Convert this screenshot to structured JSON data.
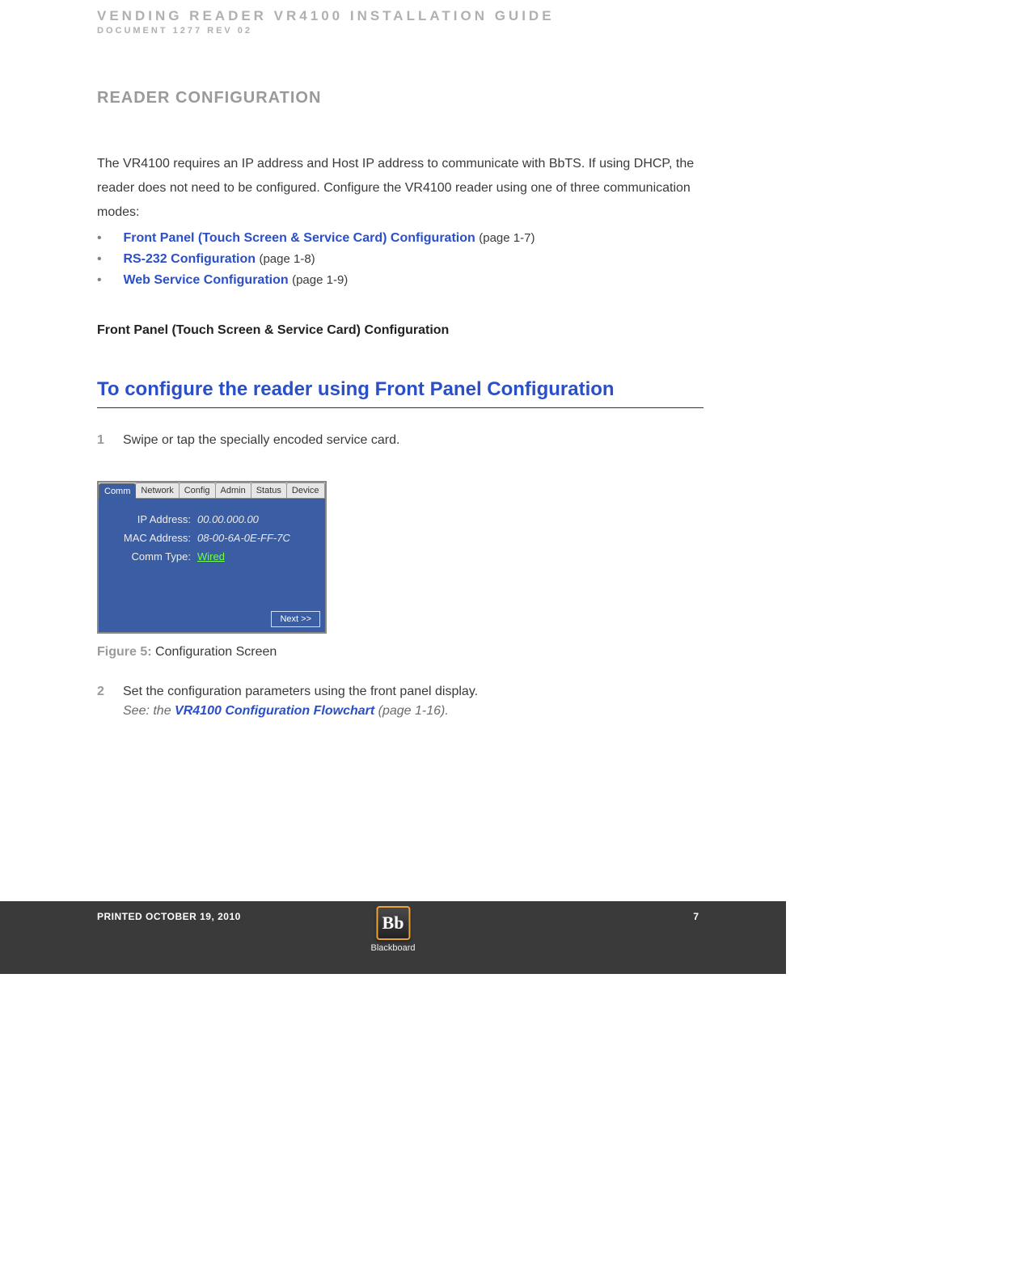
{
  "header": {
    "title": "VENDING READER VR4100 INSTALLATION GUIDE",
    "subtitle": "DOCUMENT 1277   REV 02"
  },
  "section_title": "READER CONFIGURATION",
  "intro": "The VR4100 requires an IP address and Host IP address to communicate with BbTS. If using DHCP, the reader does not need to be configured. Configure the VR4100 reader using one of three communication modes:",
  "links": [
    {
      "label": "Front Panel (Touch Screen & Service Card) Configuration",
      "page": "(page 1-7)"
    },
    {
      "label": "RS-232 Configuration",
      "page": "(page 1-8)"
    },
    {
      "label": "Web Service Configuration",
      "page": "(page 1-9)"
    }
  ],
  "subsection": "Front Panel (Touch Screen & Service Card) Configuration",
  "procedure_title": "To configure the reader using Front Panel Configuration",
  "steps": {
    "s1_num": "1",
    "s1_text": "Swipe or tap the specially encoded service card.",
    "s2_num": "2",
    "s2_text": "Set the configuration parameters using the front panel display.",
    "s2_see_prefix": "See: the ",
    "s2_see_link": "VR4100 Configuration Flowchart",
    "s2_see_suffix": " (page 1-16)."
  },
  "device": {
    "tabs": [
      "Comm",
      "Network",
      "Config",
      "Admin",
      "Status",
      "Device"
    ],
    "active_tab_index": 0,
    "rows": {
      "ip_label": "IP Address:",
      "ip_value": "00.00.000.00",
      "mac_label": "MAC Address:",
      "mac_value": "08-00-6A-0E-FF-7C",
      "comm_label": "Comm Type:",
      "comm_value": "Wired"
    },
    "next_button": "Next >>"
  },
  "figure": {
    "label": "Figure 5: ",
    "text": "Configuration Screen"
  },
  "footer": {
    "printed": "PRINTED OCTOBER 19, 2010",
    "page": "7",
    "brand_mark": "Bb",
    "brand_name": "Blackboard"
  }
}
